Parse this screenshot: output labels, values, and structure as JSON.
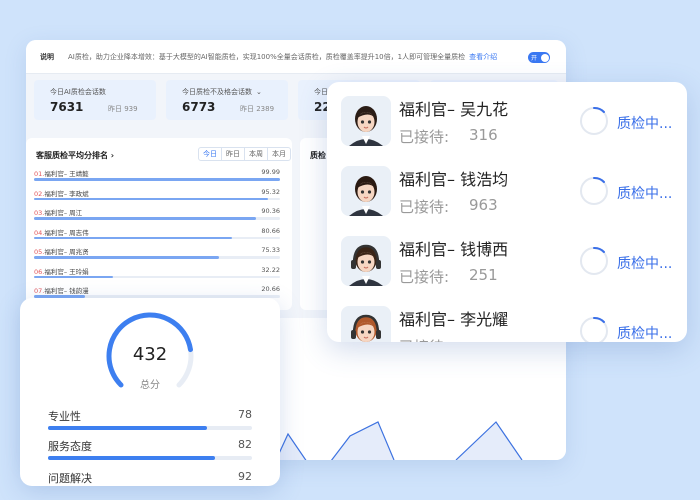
{
  "notice": {
    "label": "说明",
    "text": "AI质检，助力企业降本增效：基于大模型的AI智能质检，实现100%全量会话质检，质检覆盖率提升10倍，1人即可管理全量质检",
    "link": "查看介绍",
    "toggle": "开"
  },
  "stats": [
    {
      "title": "今日AI质检会话数",
      "value": "7631",
      "sub": "昨日 939",
      "dropdown": ""
    },
    {
      "title": "今日质检不及格会话数",
      "value": "6773",
      "sub": "昨日 2389",
      "dropdown": "⌄"
    },
    {
      "title": "今日异",
      "value": "22.",
      "sub": "",
      "dropdown": ""
    }
  ],
  "ranking": {
    "title": "客服质检平均分排名",
    "chevron": "›",
    "tabs": [
      "今日",
      "昨日",
      "本周",
      "本月"
    ],
    "active_tab": 0,
    "rows": [
      {
        "index": "01.",
        "name": "福利官– 王靖懿",
        "score": "99.99",
        "ratio": 0.9999
      },
      {
        "index": "02.",
        "name": "福利官– 李政斌",
        "score": "95.32",
        "ratio": 0.9532
      },
      {
        "index": "03.",
        "name": "福利官– 周江",
        "score": "90.36",
        "ratio": 0.9036
      },
      {
        "index": "04.",
        "name": "福利官– 周志伟",
        "score": "80.66",
        "ratio": 0.8066
      },
      {
        "index": "05.",
        "name": "福利官– 周兆贤",
        "score": "75.33",
        "ratio": 0.7533
      },
      {
        "index": "06.",
        "name": "福利官– 王玲娟",
        "score": "32.22",
        "ratio": 0.3222
      },
      {
        "index": "07.",
        "name": "福利官– 钱韵漫",
        "score": "20.66",
        "ratio": 0.2066
      }
    ]
  },
  "donut_panel": {
    "title": "质检"
  },
  "score_card": {
    "total": "432",
    "total_label": "总分",
    "gauge_ratio": 0.8,
    "metrics": [
      {
        "label": "专业性",
        "value": "78",
        "ratio": 0.78
      },
      {
        "label": "服务态度",
        "value": "82",
        "ratio": 0.82
      },
      {
        "label": "问题解决",
        "value": "92",
        "ratio": 0.92
      }
    ]
  },
  "agents": [
    {
      "name": "福利官– 吴九花",
      "label": "已接待:",
      "count": "316",
      "status": "质检中..."
    },
    {
      "name": "福利官– 钱浩均",
      "label": "已接待:",
      "count": "963",
      "status": "质检中..."
    },
    {
      "name": "福利官– 钱博西",
      "label": "已接待:",
      "count": "251",
      "status": "质检中..."
    },
    {
      "name": "福利官– 李光耀",
      "label": "已接待:",
      "count": "",
      "status": "质检中..."
    }
  ],
  "colors": {
    "accent": "#3a78f2",
    "donut": "#e02cc8",
    "status": "#3a6fe8"
  }
}
